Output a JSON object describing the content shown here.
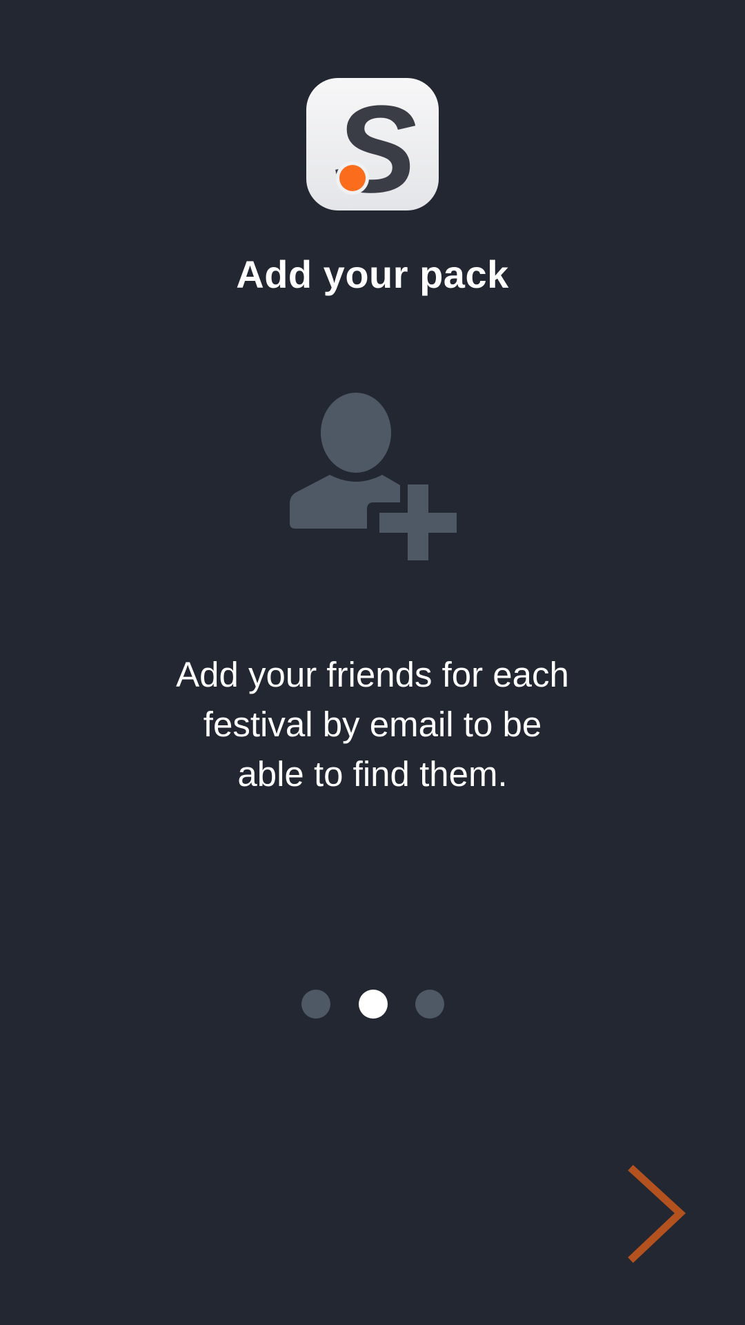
{
  "onboarding": {
    "title": "Add your pack",
    "description": "Add your friends for each\nfestival by email to be\nable to find them.",
    "logo": {
      "letter": "S",
      "letter_color": "#3a3d45",
      "dot_color": "#fb6d1c",
      "tile_color": "#f1f1f3"
    },
    "hero_icon": "add-user-icon",
    "hero_icon_color": "#4f5966"
  },
  "pager": {
    "total_pages": 3,
    "current_page": 2,
    "active_color": "#ffffff",
    "inactive_color": "#4f5966"
  },
  "navigation": {
    "next_icon": "chevron-right-icon",
    "accent_color": "#b3521e"
  },
  "colors": {
    "background": "#222731",
    "text": "#ffffff"
  }
}
